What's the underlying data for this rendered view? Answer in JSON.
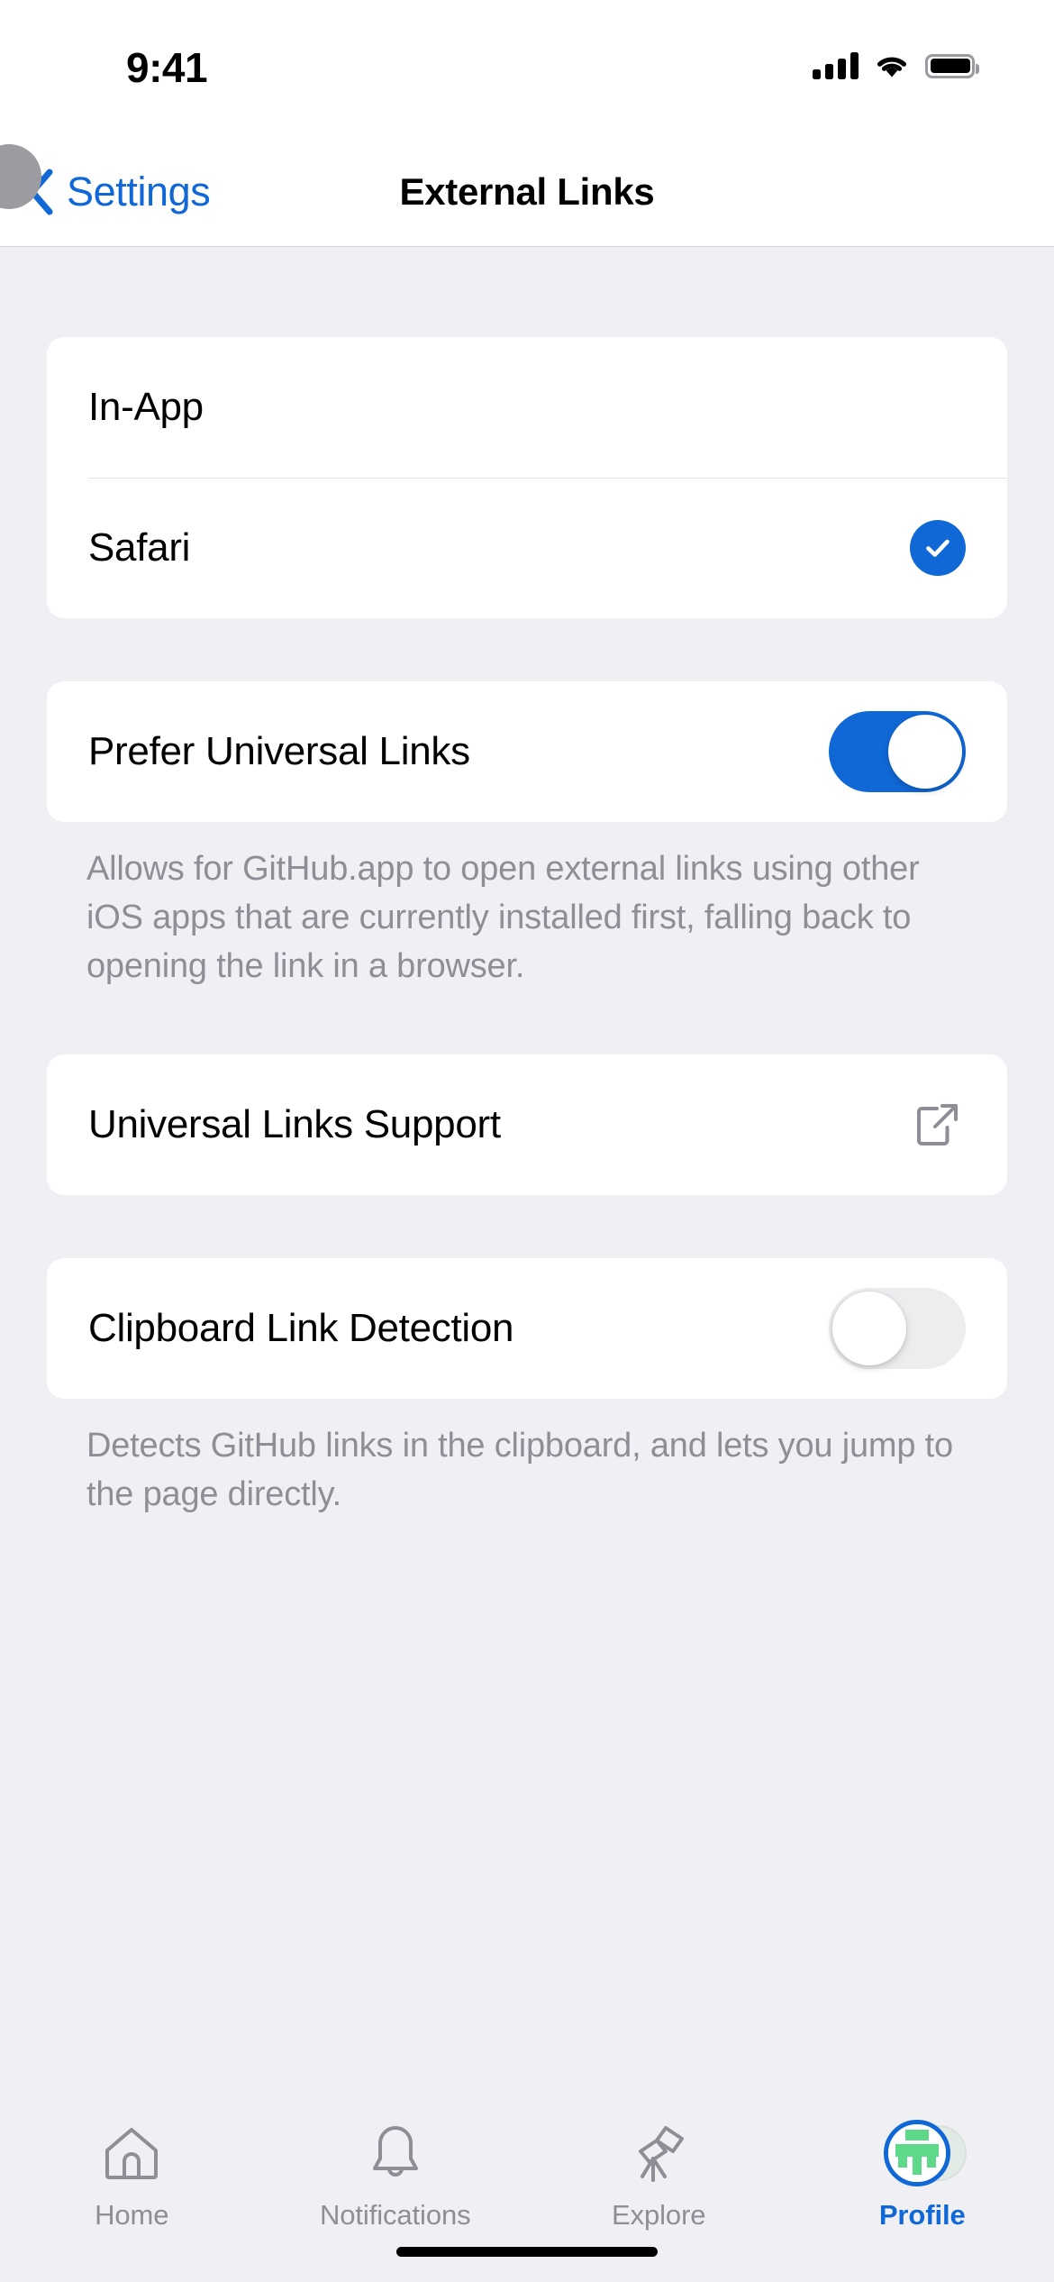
{
  "status_bar": {
    "time": "9:41",
    "cellular_icon": "signal-bars-icon",
    "wifi_icon": "wifi-icon",
    "battery_icon": "battery-full-icon"
  },
  "nav": {
    "back_label": "Settings",
    "back_icon": "chevron-left-icon",
    "title": "External Links"
  },
  "colors": {
    "accent": "#1068D7",
    "page_background": "#F0F0F4",
    "card_background": "#FFFFFF",
    "secondary_text": "#8E8E96",
    "separator": "#E1E1E6",
    "toggle_off": "#EDEDF0",
    "avatar_green": "#5ED98A"
  },
  "sections": [
    {
      "id": "browser-choice",
      "rows": [
        {
          "label": "In-App",
          "accessory": "none",
          "selected": false
        },
        {
          "label": "Safari",
          "accessory": "checkmark",
          "selected": true
        }
      ],
      "footer": ""
    },
    {
      "id": "prefer-universal-links",
      "rows": [
        {
          "label": "Prefer Universal Links",
          "accessory": "toggle",
          "toggle_state": "on"
        }
      ],
      "footer": "Allows for GitHub.app to open external links using other iOS apps that are currently installed first, falling back to opening the link in a browser."
    },
    {
      "id": "universal-links-support",
      "rows": [
        {
          "label": "Universal Links Support",
          "accessory": "external-link",
          "toggle_state": ""
        }
      ],
      "footer": ""
    },
    {
      "id": "clipboard-link-detection",
      "rows": [
        {
          "label": "Clipboard Link Detection",
          "accessory": "toggle",
          "toggle_state": "off"
        }
      ],
      "footer": "Detects GitHub links in the clipboard, and lets you jump to the page directly."
    }
  ],
  "tab_bar": {
    "items": [
      {
        "label": "Home",
        "icon": "house-icon",
        "active": false
      },
      {
        "label": "Notifications",
        "icon": "bell-icon",
        "active": false
      },
      {
        "label": "Explore",
        "icon": "telescope-icon",
        "active": false
      },
      {
        "label": "Profile",
        "icon": "avatar-icon",
        "active": true
      }
    ]
  }
}
